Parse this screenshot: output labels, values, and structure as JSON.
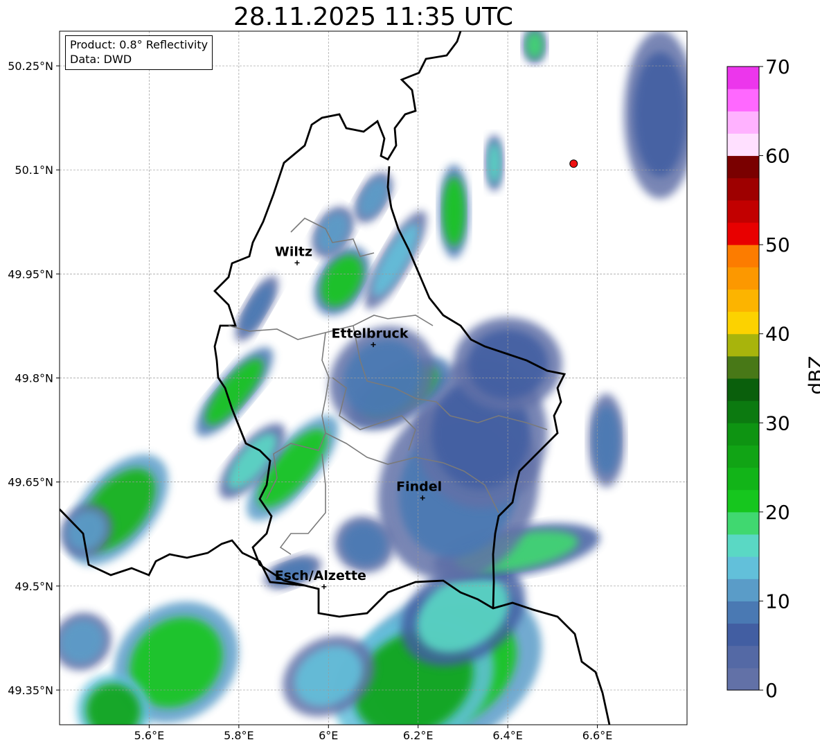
{
  "title": "28.11.2025 11:35 UTC",
  "info_box": {
    "product": "Product: 0.8° Reflectivity",
    "source": "Data: DWD"
  },
  "axes": {
    "lon_range": [
      5.4,
      6.8
    ],
    "lat_range": [
      49.3,
      50.3
    ],
    "lon_ticks": [
      5.6,
      5.8,
      6.0,
      6.2,
      6.4,
      6.6
    ],
    "lon_tick_labels": [
      "5.6°E",
      "5.8°E",
      "6°E",
      "6.2°E",
      "6.4°E",
      "6.6°E"
    ],
    "lat_ticks": [
      49.35,
      49.5,
      49.65,
      49.8,
      49.95,
      50.1,
      50.25
    ],
    "lat_tick_labels": [
      "49.35°N",
      "49.5°N",
      "49.65°N",
      "49.8°N",
      "49.95°N",
      "50.1°N",
      "50.25°N"
    ],
    "grid": true
  },
  "cities": [
    {
      "name": "Wiltz",
      "lon": 5.93,
      "lat": 49.966
    },
    {
      "name": "Ettelbruck",
      "lon": 6.1,
      "lat": 49.848
    },
    {
      "name": "Findel",
      "lon": 6.21,
      "lat": 49.627
    },
    {
      "name": "Esch/Alzette",
      "lon": 5.99,
      "lat": 49.499
    }
  ],
  "radar_site": {
    "lon": 6.547,
    "lat": 50.109,
    "color": "#ee1111"
  },
  "colorbar": {
    "label": "dBZ",
    "min": 0,
    "max": 70,
    "tick_labels": [
      "0",
      "10",
      "20",
      "30",
      "40",
      "50",
      "60",
      "70"
    ],
    "colors": [
      "#6271a7",
      "#5469a5",
      "#425ea2",
      "#4a79b3",
      "#5a9cc8",
      "#62c0da",
      "#5ad8c4",
      "#40d870",
      "#16c61e",
      "#12b418",
      "#11a415",
      "#0e9412",
      "#0c7a10",
      "#0a5f0c",
      "#487817",
      "#a8b40c",
      "#fcd200",
      "#fcb400",
      "#fc9800",
      "#fc7c00",
      "#e80000",
      "#c20000",
      "#9e0000",
      "#7a0000",
      "#ffe0ff",
      "#ffb2ff",
      "#ff68ff",
      "#ec36ec"
    ]
  },
  "echoes": [
    {
      "lon": 6.26,
      "lat": 49.38,
      "rlon": 0.17,
      "rlat": 0.08,
      "dbz": 22,
      "angle": -30
    },
    {
      "lon": 6.19,
      "lat": 49.36,
      "rlon": 0.14,
      "rlat": 0.07,
      "dbz": 25,
      "angle": -30
    },
    {
      "lon": 6.3,
      "lat": 49.46,
      "rlon": 0.11,
      "rlat": 0.05,
      "dbz": 17,
      "angle": -30
    },
    {
      "lon": 6.0,
      "lat": 49.37,
      "rlon": 0.08,
      "rlat": 0.04,
      "dbz": 14,
      "angle": -30
    },
    {
      "lon": 6.42,
      "lat": 49.55,
      "rlon": 0.04,
      "rlat": 0.09,
      "dbz": 18,
      "angle": 80
    },
    {
      "lon": 6.29,
      "lat": 49.64,
      "rlon": 0.13,
      "rlat": 0.1,
      "dbz": 8,
      "angle": 20
    },
    {
      "lon": 6.34,
      "lat": 49.72,
      "rlon": 0.11,
      "rlat": 0.08,
      "dbz": 7,
      "angle": 0
    },
    {
      "lon": 6.16,
      "lat": 49.78,
      "rlon": 0.04,
      "rlat": 0.06,
      "dbz": 21,
      "angle": 60
    },
    {
      "lon": 6.12,
      "lat": 49.8,
      "rlon": 0.08,
      "rlat": 0.06,
      "dbz": 9,
      "angle": 50
    },
    {
      "lon": 6.4,
      "lat": 49.82,
      "rlon": 0.09,
      "rlat": 0.05,
      "dbz": 6,
      "angle": 0
    },
    {
      "lon": 5.92,
      "lat": 49.67,
      "rlon": 0.04,
      "rlat": 0.07,
      "dbz": 22,
      "angle": 40
    },
    {
      "lon": 5.79,
      "lat": 49.78,
      "rlon": 0.03,
      "rlat": 0.06,
      "dbz": 20,
      "angle": 40
    },
    {
      "lon": 5.83,
      "lat": 49.68,
      "rlon": 0.03,
      "rlat": 0.05,
      "dbz": 15,
      "angle": 40
    },
    {
      "lon": 5.53,
      "lat": 49.61,
      "rlon": 0.06,
      "rlat": 0.07,
      "dbz": 24,
      "angle": 40
    },
    {
      "lon": 5.46,
      "lat": 49.58,
      "rlon": 0.04,
      "rlat": 0.03,
      "dbz": 12,
      "angle": 40
    },
    {
      "lon": 5.66,
      "lat": 49.39,
      "rlon": 0.11,
      "rlat": 0.06,
      "dbz": 22,
      "angle": -40
    },
    {
      "lon": 5.52,
      "lat": 49.32,
      "rlon": 0.06,
      "rlat": 0.04,
      "dbz": 26,
      "angle": -40
    },
    {
      "lon": 5.45,
      "lat": 49.42,
      "rlon": 0.05,
      "rlat": 0.03,
      "dbz": 10,
      "angle": -40
    },
    {
      "lon": 6.03,
      "lat": 49.94,
      "rlon": 0.04,
      "rlat": 0.04,
      "dbz": 21,
      "angle": 30
    },
    {
      "lon": 6.01,
      "lat": 50.01,
      "rlon": 0.03,
      "rlat": 0.03,
      "dbz": 12,
      "angle": 30
    },
    {
      "lon": 6.15,
      "lat": 49.97,
      "rlon": 0.025,
      "rlat": 0.06,
      "dbz": 14,
      "angle": 30
    },
    {
      "lon": 6.1,
      "lat": 50.06,
      "rlon": 0.025,
      "rlat": 0.03,
      "dbz": 12,
      "angle": 30
    },
    {
      "lon": 6.28,
      "lat": 50.04,
      "rlon": 0.025,
      "rlat": 0.05,
      "dbz": 21,
      "angle": 0
    },
    {
      "lon": 6.37,
      "lat": 50.11,
      "rlon": 0.015,
      "rlat": 0.03,
      "dbz": 17,
      "angle": 0
    },
    {
      "lon": 6.46,
      "lat": 50.28,
      "rlon": 0.02,
      "rlat": 0.02,
      "dbz": 18,
      "angle": 0
    },
    {
      "lon": 6.74,
      "lat": 50.18,
      "rlon": 0.06,
      "rlat": 0.09,
      "dbz": 6,
      "angle": 0
    },
    {
      "lon": 5.84,
      "lat": 49.9,
      "rlon": 0.02,
      "rlat": 0.04,
      "dbz": 8,
      "angle": 30
    },
    {
      "lon": 6.62,
      "lat": 49.71,
      "rlon": 0.03,
      "rlat": 0.05,
      "dbz": 8,
      "angle": 0
    },
    {
      "lon": 6.08,
      "lat": 49.56,
      "rlon": 0.05,
      "rlat": 0.03,
      "dbz": 8,
      "angle": 20
    },
    {
      "lon": 5.92,
      "lat": 49.52,
      "rlon": 0.05,
      "rlat": 0.015,
      "dbz": 8,
      "angle": -20
    }
  ]
}
